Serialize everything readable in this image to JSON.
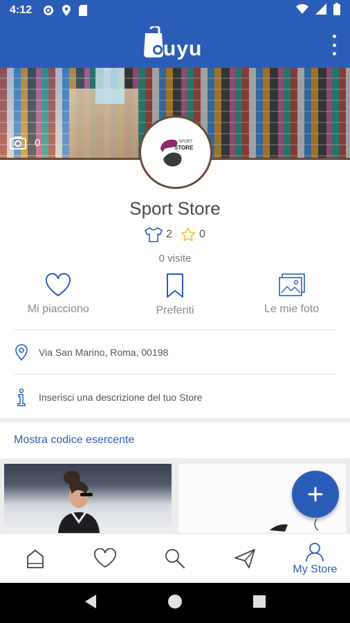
{
  "status_bar": {
    "time": "4:12",
    "left_icons": [
      "gear-icon",
      "location-icon",
      "sd-card-icon"
    ],
    "right_icons": [
      "wifi-icon",
      "signal-icon",
      "battery-icon"
    ]
  },
  "app_bar": {
    "logo_text": "uyu",
    "menu_icon": "more-vert-icon"
  },
  "cover": {
    "photo_count": "0"
  },
  "avatar": {
    "logo_top_text": "SPORT",
    "logo_bottom_text": "STORE"
  },
  "store": {
    "name": "Sport Store",
    "shirt_count": "2",
    "star_count": "0",
    "visits": "0 visite"
  },
  "actions": [
    {
      "label": "Mi piacciono",
      "icon": "heart-icon"
    },
    {
      "label": "Preferiti",
      "icon": "bookmark-icon"
    },
    {
      "label": "Le mie foto",
      "icon": "photos-icon"
    }
  ],
  "info": {
    "address": "Via San Marino, Roma, 00198",
    "description_prompt": "Inserisci una descrizione del tuo Store"
  },
  "merchant_link": "Mostra codice esercente",
  "fab_icon": "plus-icon",
  "bottom_nav": {
    "items": [
      {
        "icon": "home-icon",
        "label": ""
      },
      {
        "icon": "heart-icon",
        "label": ""
      },
      {
        "icon": "search-icon",
        "label": ""
      },
      {
        "icon": "send-icon",
        "label": ""
      },
      {
        "icon": "user-icon",
        "label": "My Store"
      }
    ]
  },
  "system_nav": [
    "back-icon",
    "home-circle-icon",
    "recents-icon"
  ],
  "colors": {
    "primary": "#2b5db8",
    "muted_text": "#8a8a8a",
    "avatar_border": "#6b4a3a",
    "star": "#f2c230"
  }
}
